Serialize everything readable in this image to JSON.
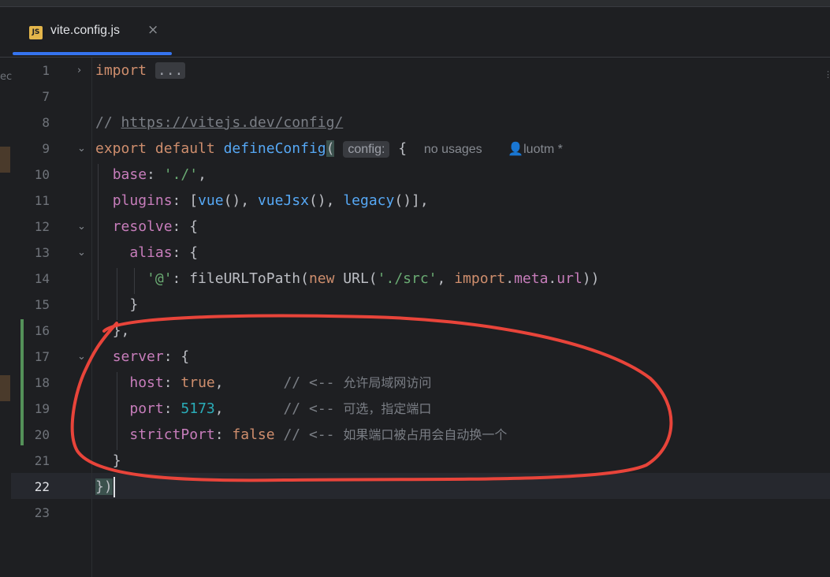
{
  "tab": {
    "icon": "JS",
    "filename": "vite.config.js",
    "close": "×"
  },
  "gutter": {
    "left_cut": "ec",
    "right_cut": "⋮"
  },
  "lines": {
    "l1": {
      "num": "1",
      "kw": "import",
      "dots": "..."
    },
    "l7": {
      "num": "7"
    },
    "l8": {
      "num": "8",
      "slash": "// ",
      "url": "https://vitejs.dev/config/"
    },
    "l9": {
      "num": "9",
      "export": "export",
      "default": "default",
      "fn": "defineConfig",
      "paren": "(",
      "hint": "config:",
      "brace": "{",
      "usages": "no usages",
      "author": "luotm *"
    },
    "l10": {
      "num": "10",
      "prop": "base",
      "colon": ": ",
      "str": "'./'",
      "end": ","
    },
    "l11": {
      "num": "11",
      "prop": "plugins",
      "p1": ": [",
      "f1": "vue",
      "p2": "(), ",
      "f2": "vueJsx",
      "p3": "(), ",
      "f3": "legacy",
      "p4": "()],"
    },
    "l12": {
      "num": "12",
      "prop": "resolve",
      "rest": ": {"
    },
    "l13": {
      "num": "13",
      "prop": "alias",
      "rest": ": {"
    },
    "l14": {
      "num": "14",
      "str1": "'@'",
      "p1": ": fileURLToPath(",
      "kw1": "new",
      "p2": " URL(",
      "str2": "'./src'",
      "p3": ", ",
      "kw2": "import",
      "p4": ".",
      "prop1": "meta",
      "p5": ".",
      "prop2": "url",
      "p6": "))"
    },
    "l15": {
      "num": "15",
      "text": "}"
    },
    "l16": {
      "num": "16",
      "text": "},"
    },
    "l17": {
      "num": "17",
      "prop": "server",
      "rest": ": {"
    },
    "l18": {
      "num": "18",
      "prop": "host",
      "colon": ": ",
      "val": "true",
      "end": ",       ",
      "cmt": "// <-- ",
      "cjk": "允许局域网访问"
    },
    "l19": {
      "num": "19",
      "prop": "port",
      "colon": ": ",
      "val": "5173",
      "end": ",       ",
      "cmt": "// <-- ",
      "cjk": "可选，指定端口"
    },
    "l20": {
      "num": "20",
      "prop": "strictPort",
      "colon": ": ",
      "val": "false",
      "end": " ",
      "cmt": "// <-- ",
      "cjk": "如果端口被占用会自动换一个"
    },
    "l21": {
      "num": "21",
      "text": "}"
    },
    "l22": {
      "num": "22",
      "text": "})"
    },
    "l23": {
      "num": "23"
    }
  },
  "colors": {
    "keyword": "#cf8e6d",
    "function": "#56a8f5",
    "string": "#6aab73",
    "property": "#c77dbb",
    "number": "#2aacb8",
    "comment": "#7a7e85",
    "annotation": "#e8443a",
    "accent": "#3574f0"
  }
}
